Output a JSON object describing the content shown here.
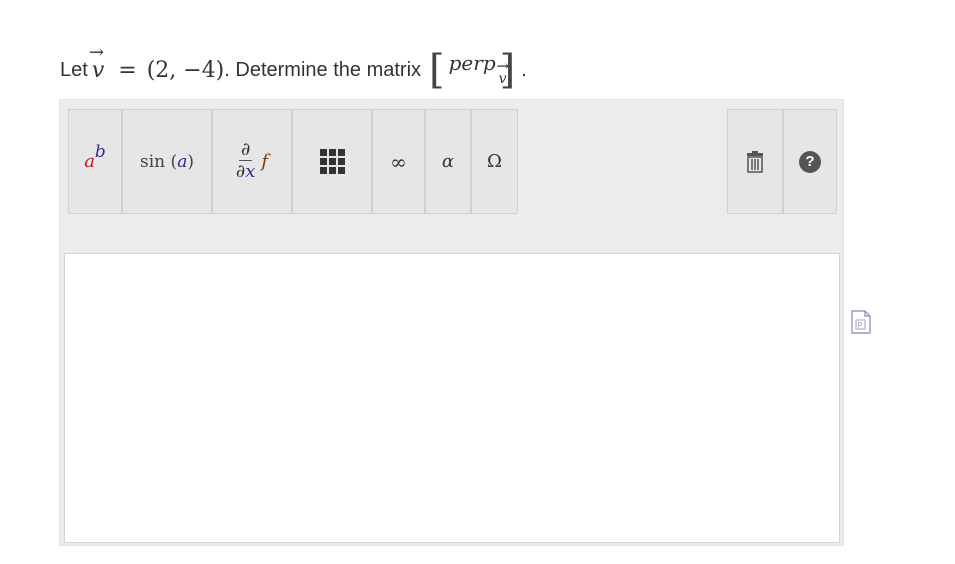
{
  "question": {
    "prefix": "Let",
    "vector_symbol": "v",
    "arrow": "→",
    "equals": "=",
    "vector_value": "(2, −4)",
    "middle_text": ". Determine the matrix",
    "matrix_expression": "perp",
    "period": "."
  },
  "toolbar": {
    "power_base": "a",
    "power_exponent": "b",
    "function_name": "sin",
    "function_open": "(",
    "function_arg": "a",
    "function_close": ")",
    "deriv_numerator": "∂",
    "deriv_denominator_symbol": "∂",
    "deriv_denominator_var": "x",
    "deriv_function": "f",
    "infinity_label": "∞",
    "alpha_label": "α",
    "omega_label": "Ω",
    "help_label": "?"
  },
  "icons": {
    "trash": "trash-icon",
    "help": "help-icon",
    "matrix": "matrix-icon",
    "side": "document-icon"
  }
}
